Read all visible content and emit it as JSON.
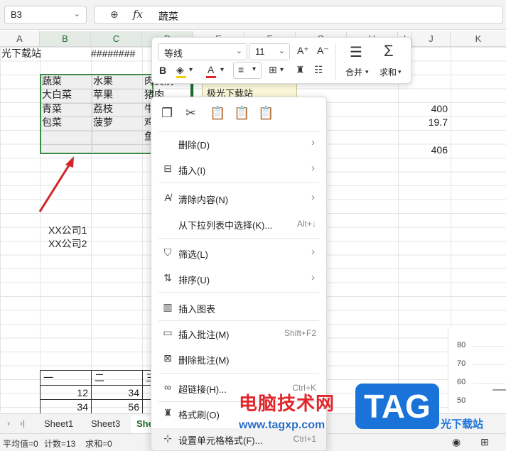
{
  "formula_bar": {
    "name_box": "B3",
    "fx_label": "fx",
    "value": "蔬菜"
  },
  "columns": [
    "A",
    "B",
    "C",
    "D",
    "E",
    "F",
    "G",
    "H",
    "I",
    "J",
    "K"
  ],
  "cells": {
    "a1": "光下载站",
    "c1": "########",
    "b3": "蔬菜",
    "c3": "水果",
    "d3": "肉类别",
    "b4": "大白菜",
    "c4": "苹果",
    "d4": "猪肉",
    "b5": "青菜",
    "c5": "荔枝",
    "d5": "牛",
    "b6": "包菜",
    "c6": "菠萝",
    "d6": "鸡",
    "d7": "鱼",
    "note": "极光下载站",
    "j5": "400",
    "j6": "19.7",
    "j8": "406",
    "b14": "XX公司1",
    "b15": "XX公司2"
  },
  "bottom_table": {
    "header": [
      "一",
      "二",
      "三"
    ],
    "rows": [
      [
        "12",
        "34",
        ""
      ],
      [
        "34",
        "56",
        ""
      ]
    ]
  },
  "chart_ticks": [
    "80",
    "70",
    "60",
    "50"
  ],
  "sheet_tabs": {
    "nav_first": "›",
    "nav_last": "›|",
    "tabs": [
      "Sheet1",
      "Sheet3",
      "She"
    ]
  },
  "status_bar": {
    "average": "平均值=0",
    "count": "计数=13",
    "sum": "求和=0"
  },
  "float_toolbar": {
    "font_name": "等线",
    "font_size": "11",
    "merge_label": "合并",
    "sum_label": "求和"
  },
  "context_menu": {
    "items": [
      {
        "label": "删除(D)",
        "shortcut": "",
        "arrow": "›"
      },
      {
        "label": "插入(I)",
        "shortcut": "",
        "arrow": "›"
      },
      {
        "label": "清除内容(N)",
        "shortcut": "",
        "arrow": "›"
      },
      {
        "label": "从下拉列表中选择(K)...",
        "shortcut": "Alt+↓",
        "arrow": ""
      },
      {
        "label": "筛选(L)",
        "shortcut": "",
        "arrow": "›"
      },
      {
        "label": "排序(U)",
        "shortcut": "",
        "arrow": "›"
      },
      {
        "label": "插入图表",
        "shortcut": "",
        "arrow": ""
      },
      {
        "label": "插入批注(M)",
        "shortcut": "Shift+F2",
        "arrow": ""
      },
      {
        "label": "删除批注(M)",
        "shortcut": "",
        "arrow": ""
      },
      {
        "label": "超链接(H)...",
        "shortcut": "Ctrl+K",
        "arrow": ""
      },
      {
        "label": "格式刷(O)",
        "shortcut": "",
        "arrow": ""
      },
      {
        "label": "设置单元格格式(F)...",
        "shortcut": "Ctrl+1",
        "arrow": ""
      }
    ]
  },
  "watermark": {
    "text": "电脑技术网",
    "url": "www.tagxp.com",
    "tag": "TAG",
    "brand": "光下载站"
  },
  "colors": {
    "accent_green": "#1f6b2e",
    "selection_border": "#3c8a44",
    "arrow_red": "#d0262b"
  }
}
